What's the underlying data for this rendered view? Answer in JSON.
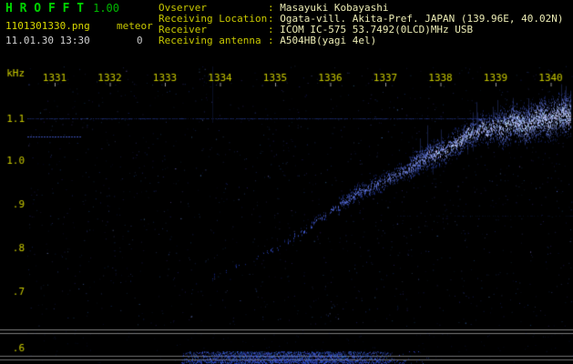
{
  "header": {
    "app_title": "H R O F F T",
    "version": "1.00",
    "filename": "1101301330.png",
    "counter_label": "meteor",
    "counter_value": "0",
    "timestamp": "11.01.30 13:30",
    "separator": ": ",
    "info_rows": [
      {
        "label": "Ovserver",
        "value": "Masayuki Kobayashi"
      },
      {
        "label": "Receiving Location",
        "value": "Ogata-vill. Akita-Pref. JAPAN (139.96E, 40.02N)"
      },
      {
        "label": "Receiver",
        "value": "ICOM IC-575 53.7492(0LCD)MHz USB"
      },
      {
        "label": "Receiving antenna",
        "value": "A504HB(yagi 4el)"
      }
    ]
  },
  "chart_data": {
    "type": "heatmap",
    "subtype": "radio-meteor-spectrogram",
    "x_axis": {
      "tick_labels": [
        "1331",
        "1332",
        "1333",
        "1334",
        "1335",
        "1336",
        "1337",
        "1338",
        "1339",
        "1340"
      ]
    },
    "y_axis": {
      "unit_label": "kHz",
      "tick_labels": [
        "1.1",
        "1.0",
        ".9",
        ".8",
        ".7",
        ".6"
      ],
      "range_khz": [
        0.6,
        1.2
      ]
    },
    "carrier_line_khz": 1.1,
    "drift_trace_points": [
      [
        1333.85,
        0.72
      ],
      [
        1334.15,
        0.735
      ],
      [
        1334.5,
        0.75
      ],
      [
        1334.85,
        0.775
      ],
      [
        1335.15,
        0.8
      ],
      [
        1335.45,
        0.825
      ],
      [
        1335.75,
        0.85
      ],
      [
        1336.05,
        0.875
      ],
      [
        1336.35,
        0.9
      ],
      [
        1336.65,
        0.925
      ],
      [
        1336.95,
        0.945
      ],
      [
        1337.25,
        0.965
      ],
      [
        1337.55,
        0.99
      ],
      [
        1337.85,
        1.015
      ],
      [
        1338.15,
        1.04
      ],
      [
        1338.45,
        1.06
      ],
      [
        1338.75,
        1.075
      ],
      [
        1339.05,
        1.085
      ],
      [
        1339.35,
        1.092
      ],
      [
        1339.65,
        1.1
      ],
      [
        1340.0,
        1.108
      ],
      [
        1340.35,
        1.115
      ]
    ],
    "bottom_band_activity_time_range": [
      1333.3,
      1337.8
    ],
    "palette": {
      "background": "#000000",
      "signal_dim": "#1a2a90",
      "signal": "#2a50e0",
      "signal_bright": "#9fb8ff",
      "grid_line": "#7a7a7a",
      "axis_text": "#c8c800"
    }
  }
}
